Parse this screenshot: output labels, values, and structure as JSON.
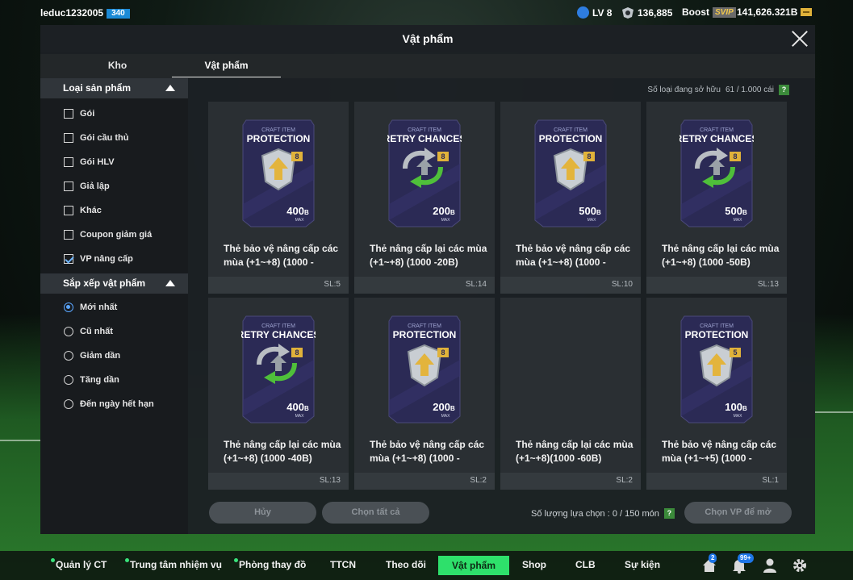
{
  "header": {
    "username": "leduc1232005",
    "user_badge": "340",
    "level": "LV 8",
    "coins": "136,885",
    "boost_label": "Boost",
    "vip_label": "SVIP",
    "bp": "141,626.321B"
  },
  "panel": {
    "title": "Vật phẩm",
    "tabs": [
      {
        "label": "Kho"
      },
      {
        "label": "Vật phẩm"
      }
    ],
    "active_tab": 1
  },
  "sidebar": {
    "category_header": "Loại sản phẩm",
    "categories": [
      {
        "label": "Gói",
        "checked": false
      },
      {
        "label": "Gói cầu thủ",
        "checked": false
      },
      {
        "label": "Gói HLV",
        "checked": false
      },
      {
        "label": "Giả lập",
        "checked": false
      },
      {
        "label": "Khác",
        "checked": false
      },
      {
        "label": "Coupon giảm giá",
        "checked": false
      },
      {
        "label": "VP nâng cấp",
        "checked": true
      }
    ],
    "sort_header": "Sắp xếp vật phẩm",
    "sorts": [
      {
        "label": "Mới nhất",
        "selected": true
      },
      {
        "label": "Cũ nhất",
        "selected": false
      },
      {
        "label": "Giảm dần",
        "selected": false
      },
      {
        "label": "Tăng dần",
        "selected": false
      },
      {
        "label": "Đến ngày hết hạn",
        "selected": false
      }
    ]
  },
  "owned": {
    "label": "Số loại đang sở hữu",
    "value": "61 / 1.000 cái",
    "help": "?"
  },
  "items": [
    {
      "card_top": "CRAFT ITEM",
      "card_name": "PROTECTION",
      "level": "8",
      "value": "400",
      "unit": "B",
      "max": "MAX",
      "title": "Thẻ bảo vệ nâng cấp các mùa (+1~+8) (1000 -",
      "qty": "SL:5"
    },
    {
      "card_top": "CRAFT ITEM",
      "card_name": "RETRY CHANCES",
      "level": "8",
      "value": "200",
      "unit": "B",
      "max": "MAX",
      "title": "Thẻ nâng cấp lại các mùa (+1~+8) (1000 -20B)",
      "qty": "SL:14"
    },
    {
      "card_top": "CRAFT ITEM",
      "card_name": "PROTECTION",
      "level": "8",
      "value": "500",
      "unit": "B",
      "max": "MAX",
      "title": "Thẻ bảo vệ nâng cấp các mùa (+1~+8) (1000 -",
      "qty": "SL:10"
    },
    {
      "card_top": "CRAFT ITEM",
      "card_name": "RETRY CHANCES",
      "level": "8",
      "value": "500",
      "unit": "B",
      "max": "MAX",
      "title": "Thẻ nâng cấp lại các mùa (+1~+8) (1000 -50B)",
      "qty": "SL:13"
    },
    {
      "card_top": "CRAFT ITEM",
      "card_name": "RETRY CHANCES",
      "level": "8",
      "value": "400",
      "unit": "B",
      "max": "MAX",
      "title": "Thẻ nâng cấp lại các mùa (+1~+8) (1000 -40B)",
      "qty": "SL:13"
    },
    {
      "card_top": "CRAFT ITEM",
      "card_name": "PROTECTION",
      "level": "8",
      "value": "200",
      "unit": "B",
      "max": "MAX",
      "title": "Thẻ bảo vệ nâng cấp các mùa (+1~+8) (1000 -",
      "qty": "SL:2"
    },
    {
      "card_top": "",
      "card_name": "",
      "level": "",
      "value": "",
      "unit": "",
      "max": "",
      "title": "Thẻ nâng cấp lại các mùa (+1~+8)(1000 -60B)",
      "qty": "SL:2"
    },
    {
      "card_top": "CRAFT ITEM",
      "card_name": "PROTECTION",
      "level": "5",
      "value": "100",
      "unit": "B",
      "max": "MAX",
      "title": "Thẻ bảo vệ nâng cấp các mùa (+1~+5) (1000 -",
      "qty": "SL:1"
    }
  ],
  "footer": {
    "cancel": "Hủy",
    "select_all": "Chọn tất cả",
    "selection_label": "Số lượng lựa chọn : 0 / 150 món",
    "help": "?",
    "choose": "Chọn VP để mở"
  },
  "bottom_nav": {
    "items": [
      "Quản lý CT",
      "Trung tâm nhiệm vụ",
      "Phòng thay đồ",
      "TTCN",
      "Theo dõi",
      "Vật phẩm",
      "Shop",
      "CLB",
      "Sự kiện"
    ],
    "home_badge": "2",
    "bell_badge": "99+"
  },
  "colors": {
    "accent_green": "#2ee06b",
    "panel": "#1c2024",
    "card": "#2a2f33",
    "card_art": "#2b2a55"
  }
}
